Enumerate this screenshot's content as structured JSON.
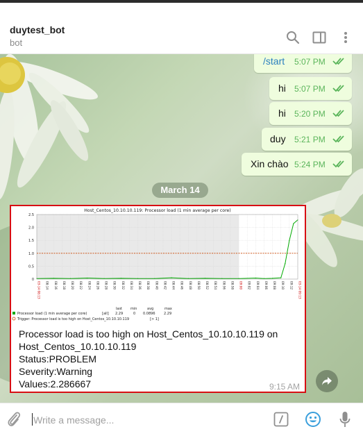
{
  "header": {
    "peer_name": "duytest_bot",
    "peer_status": "bot"
  },
  "messages": [
    {
      "text": "/start",
      "time": "5:07 PM",
      "is_command": true
    },
    {
      "text": "hi",
      "time": "5:07 PM"
    },
    {
      "text": "hi",
      "time": "5:20 PM"
    },
    {
      "text": "duy",
      "time": "5:21 PM"
    },
    {
      "text": "Xin chào",
      "time": "5:24 PM"
    }
  ],
  "date_separator": "March 14",
  "bot_message": {
    "caption_lines": [
      "Processor load is too high on Host_Centos_10.10.10.119 on",
      "Host_Centos_10.10.10.119",
      "Status:PROBLEM",
      "Severity:Warning",
      "Values:2.286667"
    ],
    "time": "9:15 AM"
  },
  "chart_data": {
    "type": "line",
    "title": "Host_Centos_10.10.10.119: Processor load (1 min average per core)",
    "ylim": [
      0,
      2.5
    ],
    "y_ticks": [
      "0",
      "0.5",
      "1.0",
      "1.5",
      "2.0",
      "2.5"
    ],
    "x_ticks": [
      "03-14 08:13",
      "08:14",
      "08:16",
      "08:18",
      "08:20",
      "08:22",
      "08:24",
      "08:26",
      "08:28",
      "08:30",
      "08:32",
      "08:34",
      "08:36",
      "08:38",
      "08:40",
      "08:42",
      "08:44",
      "08:46",
      "08:48",
      "08:50",
      "08:52",
      "08:54",
      "08:56",
      "08:58",
      "09:00",
      "09:02",
      "09:04",
      "09:06",
      "09:08",
      "09:10",
      "09:12",
      "03-14 09:13"
    ],
    "x_ticks_red": [
      0,
      24,
      31
    ],
    "shaded_until_tick": 24,
    "series": [
      {
        "name": "Processor load (1 min average per core)",
        "color": "#00aa00",
        "x_index": [
          0,
          2,
          4,
          6,
          8,
          10,
          12,
          14,
          16,
          18,
          20,
          22,
          24,
          26,
          27,
          28,
          29,
          29.5,
          30,
          30.5,
          31
        ],
        "values": [
          0.02,
          0.03,
          0.02,
          0.04,
          0.02,
          0.03,
          0.02,
          0.02,
          0.05,
          0.02,
          0.03,
          0.02,
          0.02,
          0.04,
          0.02,
          0.03,
          0.05,
          0.6,
          1.5,
          2.15,
          2.29
        ]
      }
    ],
    "trigger": {
      "name": "Trigger: Processor load is too high on Host_Centos_10.10.10.119",
      "threshold_label": "[> 1]",
      "value": 1.0,
      "color": "#cc4400"
    },
    "legend": {
      "headers": [
        "last",
        "min",
        "avg",
        "max"
      ],
      "series_scope": "[all]",
      "series_values": [
        "2.29",
        "0",
        "0.0896",
        "2.29"
      ]
    }
  },
  "composer": {
    "placeholder": "Write a message..."
  },
  "icons": {
    "header": [
      "search-icon",
      "sidebar-toggle-icon",
      "more-vertical-icon"
    ],
    "composer": [
      "attach-icon",
      "commands-icon",
      "emoji-icon",
      "microphone-icon"
    ],
    "share": "share-icon"
  },
  "colors": {
    "outgoing_bubble": "#effdde",
    "read_ticks": "#5bb55b",
    "highlight_border": "#d80e13",
    "emoji_icon": "#3a9fdc"
  }
}
